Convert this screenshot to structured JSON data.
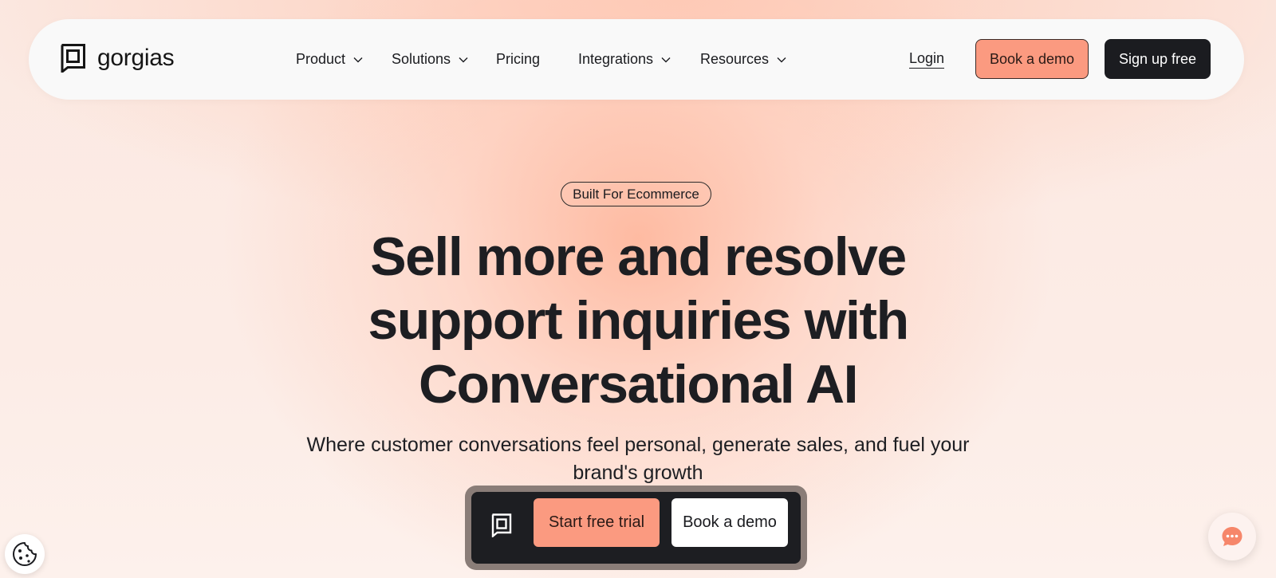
{
  "nav": {
    "logo_text": "gorgias",
    "items": [
      {
        "label": "Product",
        "has_dropdown": true
      },
      {
        "label": "Solutions",
        "has_dropdown": true
      },
      {
        "label": "Pricing",
        "has_dropdown": false
      },
      {
        "label": "Integrations",
        "has_dropdown": true
      },
      {
        "label": "Resources",
        "has_dropdown": true
      }
    ],
    "login_label": "Login",
    "book_demo_label": "Book a demo",
    "signup_label": "Sign up free"
  },
  "hero": {
    "badge": "Built For Ecommerce",
    "headline_lines": [
      "Sell more and resolve",
      "support inquiries with",
      "Conversational AI"
    ],
    "subhead_lines": [
      "Where customer conversations feel personal, generate sales, and fuel your",
      "brand's growth"
    ]
  },
  "cta_bar": {
    "trial_label": "Start free trial",
    "demo_label": "Book a demo"
  },
  "icons": {
    "logo": "gorgias-logo-icon",
    "chevron": "chevron-down-icon",
    "cookie": "cookie-icon",
    "chat": "chat-bubble-icon"
  },
  "colors": {
    "accent": "#fb9a80",
    "dark": "#1b1c20",
    "nav_bg": "#f9f9f9"
  }
}
